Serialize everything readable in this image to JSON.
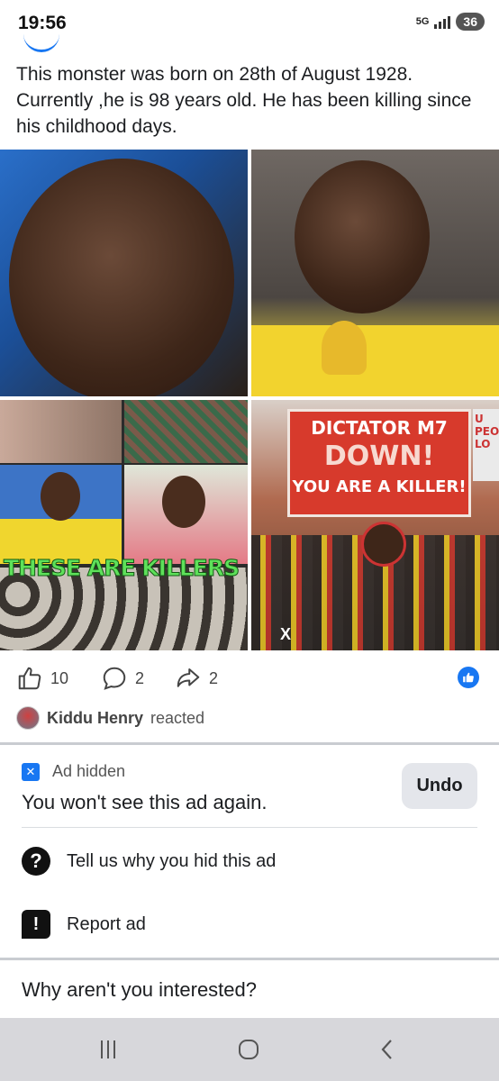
{
  "status_bar": {
    "time": "19:56",
    "network": "5G",
    "battery": "36"
  },
  "post": {
    "text": "This monster was born on 28th of August 1928. Currently ,he is 98 years old. He has been killing since his childhood days.",
    "collage": {
      "overlay_text": "THESE ARE KILLERS",
      "sign_line1": "DICTATOR M7",
      "sign_line2": "DOWN!",
      "sign_line3": "YOU ARE A KILLER!",
      "sign_side": "U PEO LO",
      "watermark": "X"
    },
    "stats": {
      "likes": "10",
      "comments": "2",
      "shares": "2"
    },
    "reacted": {
      "name": "Kiddu Henry",
      "suffix": "reacted"
    }
  },
  "ad_hidden": {
    "label": "Ad hidden",
    "title": "You won't see this ad again.",
    "undo_label": "Undo",
    "menu": [
      {
        "label": "Tell us why you hid this ad",
        "icon": "question-icon"
      },
      {
        "label": "Report ad",
        "icon": "report-icon"
      }
    ],
    "question": "Why aren't you interested?"
  },
  "colors": {
    "accent": "#1877f2",
    "divider": "#c9ccd1",
    "nav_bg": "#d7d7db"
  }
}
